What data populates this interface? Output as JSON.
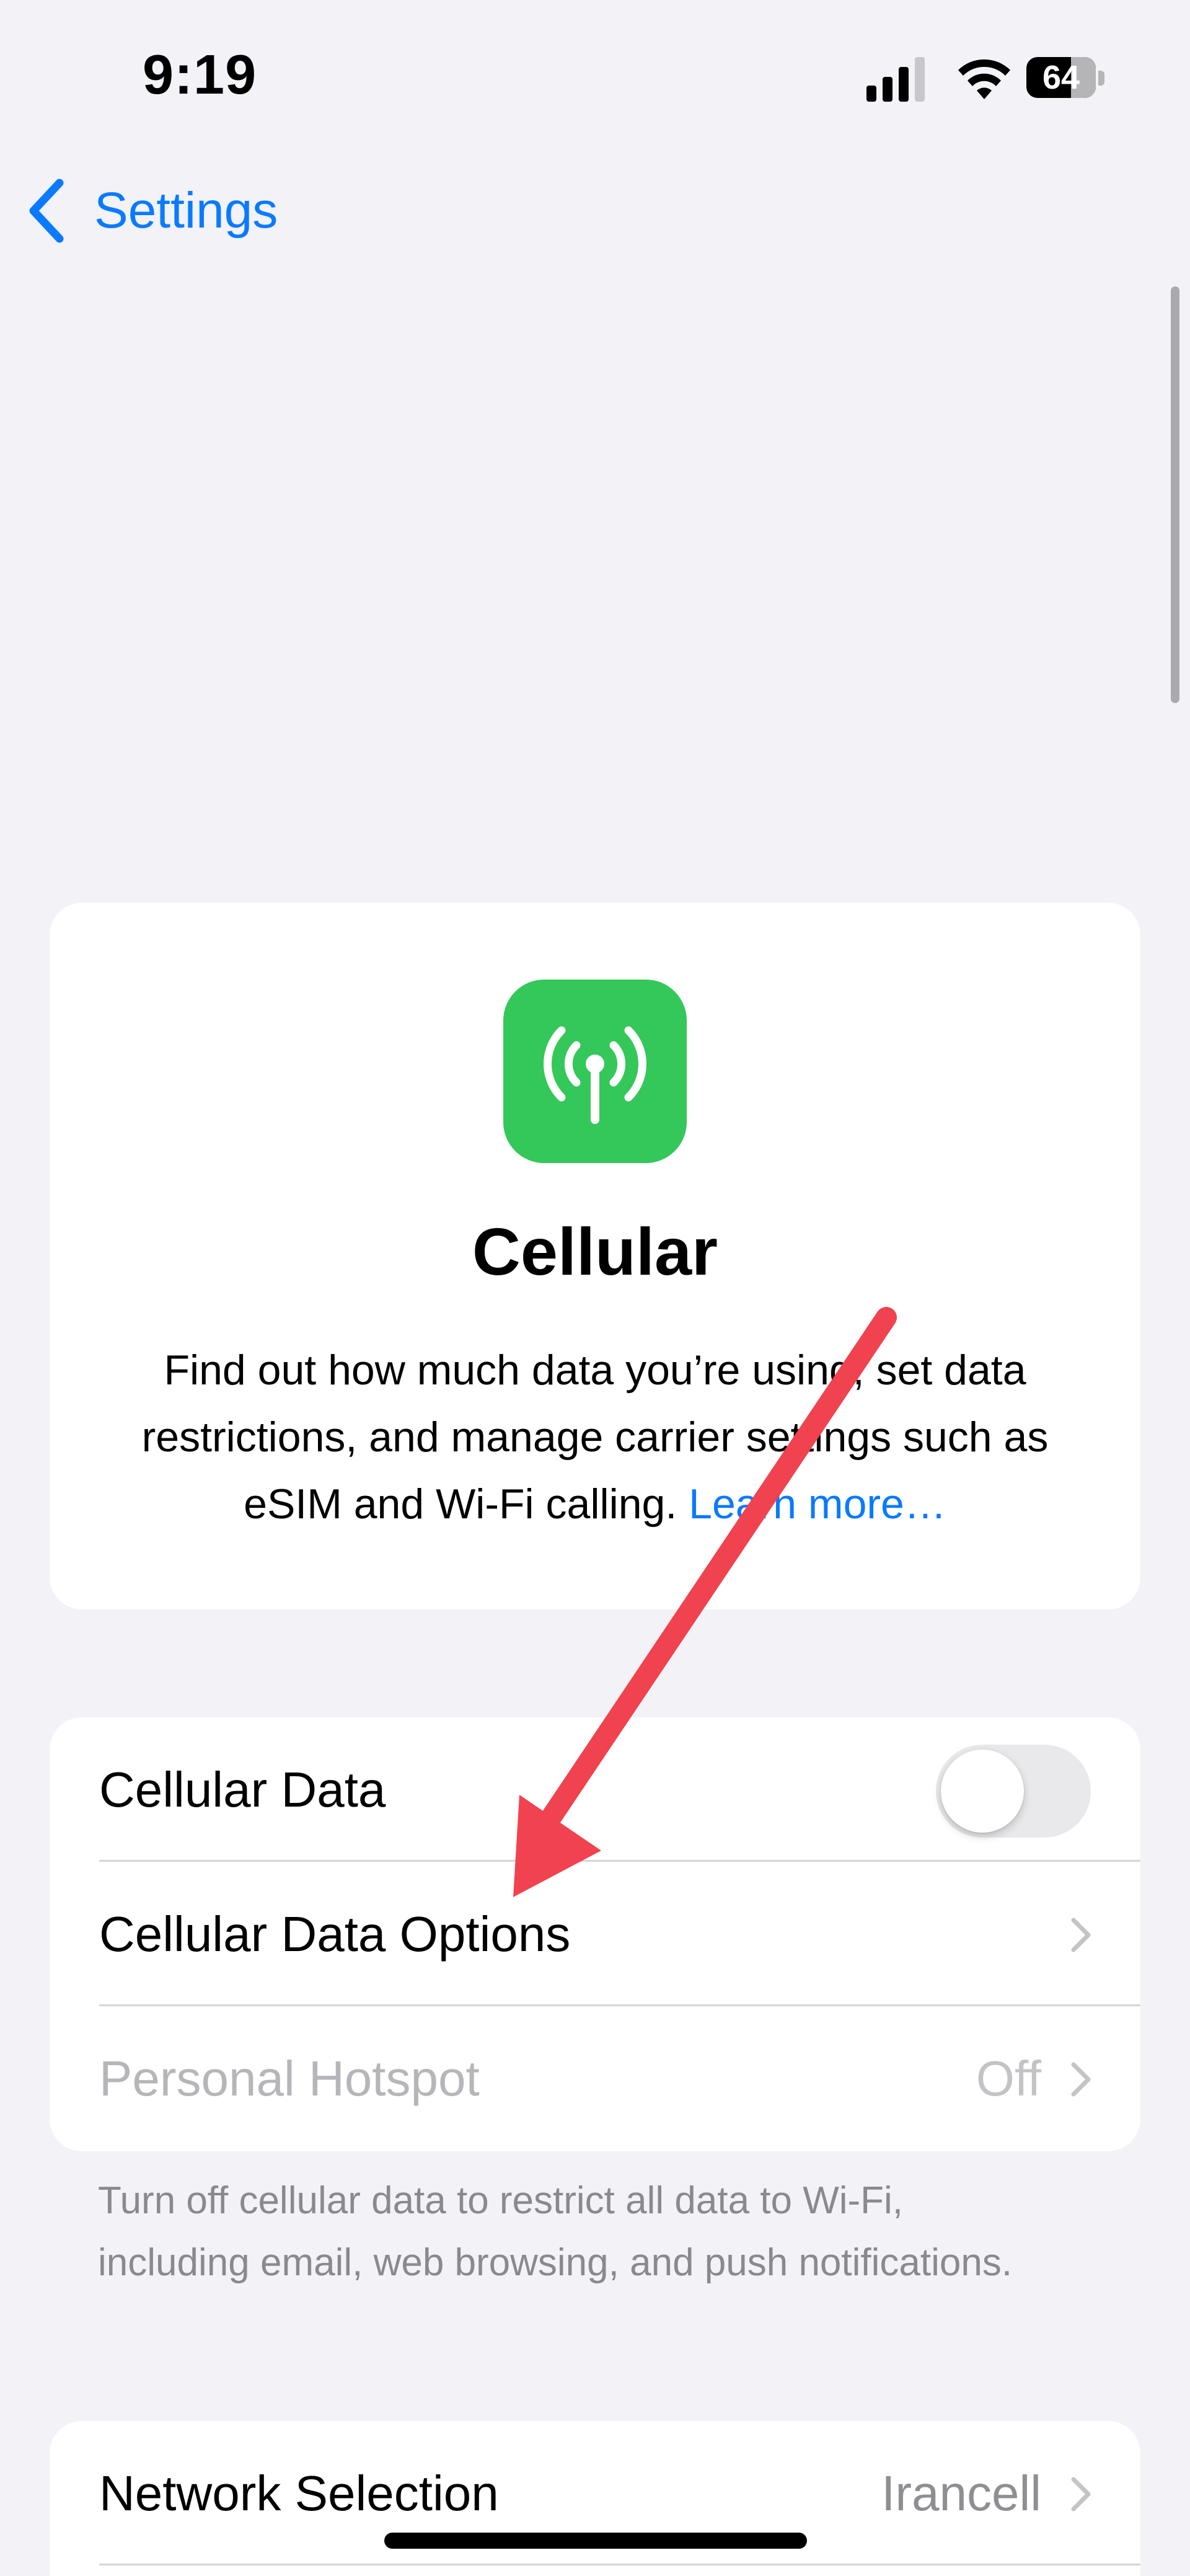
{
  "status_bar": {
    "time": "9:19",
    "battery_level": "64",
    "battery_fraction": 0.64,
    "signal_bars_filled": 3,
    "signal_bars_total": 4,
    "icons": [
      "cellular-signal-icon",
      "wifi-icon",
      "battery-icon"
    ]
  },
  "nav": {
    "back_label": "Settings",
    "back_icon": "chevron-left-icon"
  },
  "header": {
    "icon": "antenna-icon",
    "icon_color": "#34c759",
    "title": "Cellular",
    "description": "Find out how much data you’re using, set data restrictions, and manage carrier settings such as eSIM and Wi-Fi calling.",
    "learn_more": "Learn more…"
  },
  "cellular_group": {
    "cellular_data": {
      "label": "Cellular Data",
      "toggle_on": false
    },
    "data_options": {
      "label": "Cellular Data Options"
    },
    "hotspot": {
      "label": "Personal Hotspot",
      "value": "Off",
      "enabled": false
    },
    "footer": "Turn off cellular data to restrict all data to Wi-Fi, including email, web browsing, and push notifications."
  },
  "network_group": {
    "network_selection": {
      "label": "Network Selection",
      "value": "Irancell"
    }
  },
  "annotation": {
    "arrow_color": "#f0424f",
    "points_to": "Cellular Data Options"
  },
  "colors": {
    "accent": "#0a7aff",
    "background": "#f2f2f7",
    "secondary_text": "#8e8e93"
  }
}
